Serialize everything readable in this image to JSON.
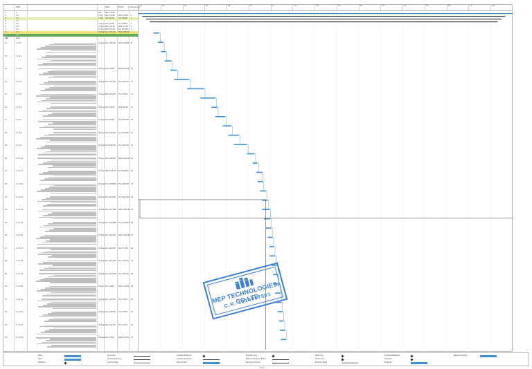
{
  "columns": {
    "id": "",
    "wbs": "WBS",
    "name": "",
    "duration": "",
    "start": "Start",
    "finish": "Finish",
    "pred": "Predecessors"
  },
  "timescale_labels": [
    "Jan",
    "Feb",
    "Mar",
    "Apr",
    "May",
    "Jun",
    "Jul",
    "Aug",
    "Sep",
    "Oct",
    "Nov",
    "Dec",
    "Jan",
    "Feb",
    "Mar",
    "Apr",
    "May"
  ],
  "summary_rows": [
    {
      "id": "1",
      "wbs": "1",
      "name": "",
      "duration": "445",
      "start": "Mon 3/5/18",
      "finish": "",
      "pred": "",
      "style": "plain"
    },
    {
      "id": "2",
      "wbs": "1.1",
      "name": "",
      "duration": "1 day",
      "start": "Mon 3/5/18",
      "finish": "Mon 3/5/18",
      "pred": "1",
      "style": "plain"
    },
    {
      "id": "3",
      "wbs": "1.2",
      "name": "",
      "duration": "1 day",
      "start": "Tue 3/6/18",
      "finish": "Tue 3/6/18",
      "pred": "2",
      "style": "hl"
    },
    {
      "id": "4",
      "wbs": "1.3",
      "name": "",
      "duration": "",
      "start": "",
      "finish": "",
      "pred": "",
      "style": "plain"
    },
    {
      "id": "5",
      "wbs": "1.4",
      "name": "",
      "duration": "3 days",
      "start": "Sun 3/4/18",
      "finish": "Thu 3/8/18",
      "pred": "3",
      "style": "plain"
    },
    {
      "id": "6",
      "wbs": "1.5",
      "name": "",
      "duration": "3 days",
      "start": "Mon 3/5/18",
      "finish": "Wed 3/7/18",
      "pred": "3",
      "style": "plain"
    },
    {
      "id": "7",
      "wbs": "1.6",
      "name": "",
      "duration": "5 days",
      "start": "Wed 3/7/18",
      "finish": "Tue 3/13/18",
      "pred": "5",
      "style": "plain"
    },
    {
      "id": "8",
      "wbs": "1.7",
      "name": "",
      "duration": "30 days",
      "start": "Sun 3/11/18",
      "finish": "Wed 4/18/18",
      "pred": "",
      "style": "yellow"
    },
    {
      "id": "9",
      "wbs": "1.8",
      "name": "",
      "duration": "",
      "start": "",
      "finish": "",
      "pred": "",
      "style": "green"
    },
    {
      "id": "10",
      "wbs": "1.9",
      "name": "",
      "duration": "",
      "start": "",
      "finish": "",
      "pred": "",
      "style": "big"
    }
  ],
  "tasks": [
    {
      "id": "11",
      "wbs": "1.1.5.1",
      "duration": "19 days",
      "start": "Sun 3/25/18",
      "finish": "Wed 4/18/18",
      "pred": "8"
    },
    {
      "id": "12",
      "wbs": "1.1.5.2",
      "duration": "",
      "start": "",
      "finish": "",
      "pred": ""
    },
    {
      "id": "13",
      "wbs": "1.1.5.3",
      "duration": "29 days",
      "start": "Sun 5/6/18",
      "finish": "Wed 6/13/18",
      "pred": "12"
    },
    {
      "id": "14",
      "wbs": "1.1.5.4",
      "duration": "30 days",
      "start": "Sun 5/13/18",
      "finish": "Thu 6/21/18",
      "pred": "13"
    },
    {
      "id": "15",
      "wbs": "1.1.5.5",
      "duration": "19 days",
      "start": "Mon 6/11/18",
      "finish": "Thu 7/5/18",
      "pred": "14"
    },
    {
      "id": "16",
      "wbs": "1.1.5.6",
      "duration": "20 days",
      "start": "Thu 7/5/18",
      "finish": "Wed 8/1/18",
      "pred": "15"
    },
    {
      "id": "17",
      "wbs": "1.1.5.7",
      "duration": "15 days",
      "start": "Sun 8/5/18",
      "finish": "Thu 8/23/18",
      "pred": "16"
    },
    {
      "id": "18",
      "wbs": "1.1.5.8",
      "duration": "26 days",
      "start": "Sun 8/19/18",
      "finish": "Sun 9/23/18",
      "pred": "17"
    },
    {
      "id": "19",
      "wbs": "1.1.5.9",
      "duration": "30 days",
      "start": "Sun 8/19/18",
      "finish": "Thu 9/27/18",
      "pred": "17"
    },
    {
      "id": "20",
      "wbs": "1.1.5.10",
      "duration": "8 days",
      "start": "Sun 9/30/18",
      "finish": "Wed 10/10/18",
      "pred": "19"
    },
    {
      "id": "21",
      "wbs": "1.1.5.11",
      "duration": "20 days",
      "start": "Mon 10/1/18",
      "finish": "Fri 10/26/18",
      "pred": "20"
    },
    {
      "id": "22",
      "wbs": "1.1.5.12",
      "duration": "30 days",
      "start": "Sun 10/28/18",
      "finish": "Thu 12/6/18",
      "pred": "21"
    },
    {
      "id": "23",
      "wbs": "1.1.5.13",
      "duration": "30 days",
      "start": "Sun 11/4/18",
      "finish": "Thu 12/13/18",
      "pred": "22"
    },
    {
      "id": "24",
      "wbs": "1.1.5.14",
      "duration": "34 days",
      "start": "Sun 11/11/18",
      "finish": "Wed 12/26/18",
      "pred": "23"
    },
    {
      "id": "25",
      "wbs": "1.1.5.15",
      "duration": "25 days",
      "start": "Sun 11/18/18",
      "finish": "Thu 12/20/18",
      "pred": "24"
    },
    {
      "id": "26",
      "wbs": "1.1.5.16",
      "duration": "19 days",
      "start": "Sun 12/2/18",
      "finish": "Wed 12/26/18",
      "pred": "25"
    },
    {
      "id": "27",
      "wbs": "1.1.5.17",
      "duration": "22 days",
      "start": "Sun 12/9/18",
      "finish": "Mon 1/7/19",
      "pred": "26"
    },
    {
      "id": "28",
      "wbs": "1.1.5.18",
      "duration": "30 days",
      "start": "Sun 12/16/18",
      "finish": "Thu 1/24/19",
      "pred": "27"
    },
    {
      "id": "29",
      "wbs": "1.1.5.19",
      "duration": "26 days",
      "start": "Sun 12/23/18",
      "finish": "Sun 1/27/19",
      "pred": "28"
    },
    {
      "id": "30",
      "wbs": "1.1.5.20",
      "duration": "8 days",
      "start": "Sun 1/6/19",
      "finish": "Wed 1/16/19",
      "pred": "29"
    },
    {
      "id": "31",
      "wbs": "1.1.5.21",
      "duration": "20 days",
      "start": "Sun 1/13/19",
      "finish": "Thu 2/7/19",
      "pred": "30"
    },
    {
      "id": "32",
      "wbs": "1.1.5.22",
      "duration": "15 days",
      "start": "Sun 1/20/19",
      "finish": "Thu 2/7/19",
      "pred": "31"
    },
    {
      "id": "33",
      "wbs": "1.1.5.23",
      "duration": "30 days",
      "start": "Sun 1/27/19",
      "finish": "Thu 3/7/19",
      "pred": "32"
    },
    {
      "id": "34",
      "wbs": "1.1.5.24",
      "duration": "19 days",
      "start": "Sun 2/3/19",
      "finish": "Wed 2/27/19",
      "pred": "33"
    }
  ],
  "gantt": {
    "accent": "#3d8fd1",
    "summary_color": "#333333",
    "top_summary_bars": [
      {
        "from": 0.0,
        "to": 1.0
      },
      {
        "from": 0.01,
        "to": 0.98
      },
      {
        "from": 0.02,
        "to": 0.97
      },
      {
        "from": 0.03,
        "to": 0.96
      }
    ],
    "task_bars": [
      {
        "from": 0.04,
        "to": 0.055
      },
      {
        "from": 0.052,
        "to": 0.066
      },
      {
        "from": 0.06,
        "to": 0.072
      },
      {
        "from": 0.07,
        "to": 0.088
      },
      {
        "from": 0.085,
        "to": 0.102
      },
      {
        "from": 0.095,
        "to": 0.135
      },
      {
        "from": 0.13,
        "to": 0.175
      },
      {
        "from": 0.165,
        "to": 0.205
      },
      {
        "from": 0.195,
        "to": 0.21
      },
      {
        "from": 0.205,
        "to": 0.232
      },
      {
        "from": 0.225,
        "to": 0.248
      },
      {
        "from": 0.24,
        "to": 0.268
      },
      {
        "from": 0.255,
        "to": 0.29
      },
      {
        "from": 0.29,
        "to": 0.31
      },
      {
        "from": 0.305,
        "to": 0.318
      },
      {
        "from": 0.315,
        "to": 0.33
      },
      {
        "from": 0.318,
        "to": 0.332
      },
      {
        "from": 0.325,
        "to": 0.34
      },
      {
        "from": 0.33,
        "to": 0.345
      },
      {
        "from": 0.33,
        "to": 0.35
      },
      {
        "from": 0.335,
        "to": 0.352
      },
      {
        "from": 0.34,
        "to": 0.355
      },
      {
        "from": 0.345,
        "to": 0.358
      },
      {
        "from": 0.35,
        "to": 0.362
      },
      {
        "from": 0.35,
        "to": 0.365
      },
      {
        "from": 0.355,
        "to": 0.37
      },
      {
        "from": 0.36,
        "to": 0.372
      },
      {
        "from": 0.362,
        "to": 0.376
      },
      {
        "from": 0.365,
        "to": 0.38
      },
      {
        "from": 0.368,
        "to": 0.382
      },
      {
        "from": 0.372,
        "to": 0.385
      },
      {
        "from": 0.375,
        "to": 0.388
      },
      {
        "from": 0.378,
        "to": 0.392
      },
      {
        "from": 0.38,
        "to": 0.395
      }
    ],
    "summary_brackets": [
      {
        "row_from": 18,
        "row_to": 20,
        "from": 0.0,
        "to": 1.0
      }
    ]
  },
  "legend": {
    "project": "",
    "items": [
      {
        "label": "Task",
        "kind": "task"
      },
      {
        "label": "Split",
        "kind": "split"
      },
      {
        "label": "Milestone",
        "kind": "milestone"
      },
      {
        "label": "Summary",
        "kind": "summary"
      },
      {
        "label": "Project Summary",
        "kind": "psummary"
      },
      {
        "label": "Inactive Task",
        "kind": "inactive"
      },
      {
        "label": "Inactive Milestone",
        "kind": "inactive-ms"
      },
      {
        "label": "Inactive Summary",
        "kind": "inactive-sum"
      },
      {
        "label": "Manual Task",
        "kind": "manual"
      },
      {
        "label": "Duration-only",
        "kind": "duronly"
      },
      {
        "label": "Manual Summary Rollup",
        "kind": "msr"
      },
      {
        "label": "Manual Summary",
        "kind": "ms"
      },
      {
        "label": "Start-only",
        "kind": "startonly"
      },
      {
        "label": "Finish-only",
        "kind": "finishonly"
      },
      {
        "label": "External Tasks",
        "kind": "ext"
      },
      {
        "label": "External Milestone",
        "kind": "extms"
      },
      {
        "label": "Deadline",
        "kind": "deadline"
      },
      {
        "label": "Progress",
        "kind": "progress"
      },
      {
        "label": "Manual Progress",
        "kind": "mprogress"
      }
    ]
  },
  "page_number": "Page 1",
  "stamp": {
    "name": "MEP TECHNOLOGIES, CO.LTD",
    "reg": "C.R. 1010887901",
    "color": "#3d7fd4"
  }
}
